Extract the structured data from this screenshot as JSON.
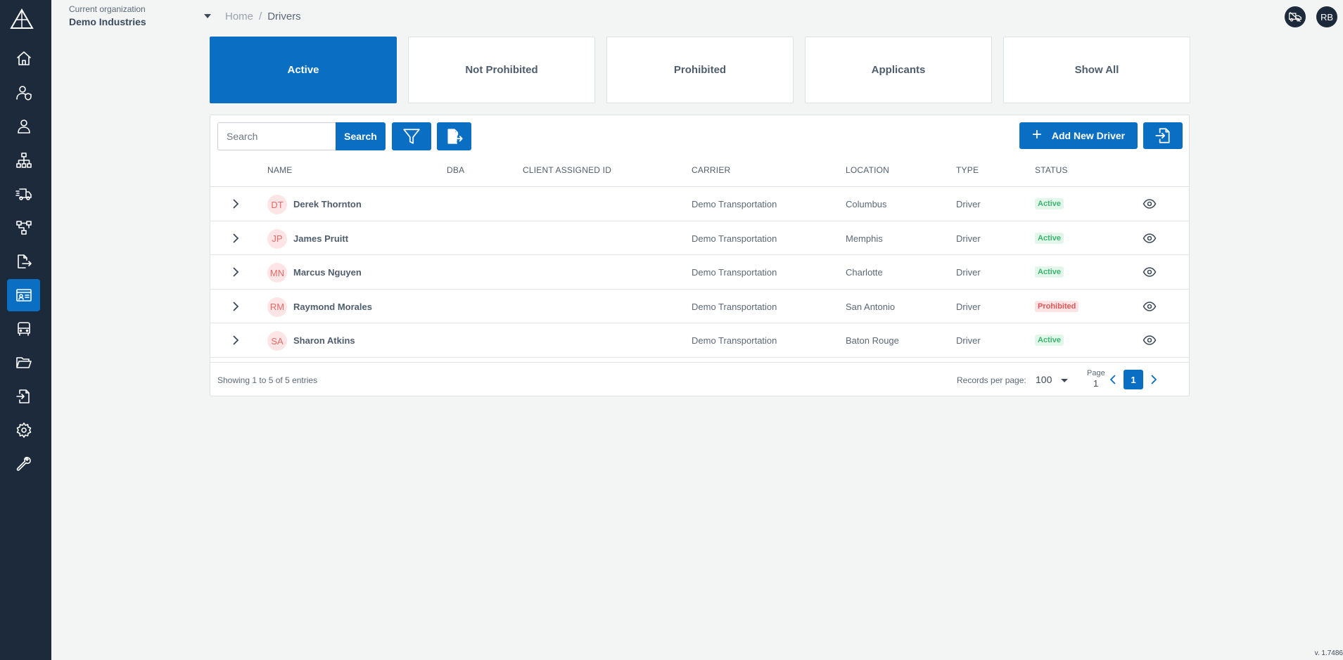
{
  "app": {
    "org_label": "Current organization",
    "org_name": "Demo Industries",
    "version": "v. 1.7486"
  },
  "header": {
    "breadcrumb": {
      "home": "Home",
      "separator": "/",
      "current": "Drivers"
    },
    "user_initials": "RB"
  },
  "sidebar": {
    "items": [
      {
        "icon": "home-icon"
      },
      {
        "icon": "user-shield-icon"
      },
      {
        "icon": "user-icon"
      },
      {
        "icon": "org-chart-icon"
      },
      {
        "icon": "truck-fast-icon"
      },
      {
        "icon": "workflow-icon"
      },
      {
        "icon": "file-export-icon"
      },
      {
        "icon": "id-card-icon",
        "active": true
      },
      {
        "icon": "vehicle-icon"
      },
      {
        "icon": "folder-open-icon"
      },
      {
        "icon": "file-import-icon"
      },
      {
        "icon": "settings-gear-icon"
      },
      {
        "icon": "wrench-icon"
      }
    ]
  },
  "tabs": [
    {
      "label": "Active",
      "active": true
    },
    {
      "label": "Not Prohibited"
    },
    {
      "label": "Prohibited"
    },
    {
      "label": "Applicants"
    },
    {
      "label": "Show All"
    }
  ],
  "toolbar": {
    "search_placeholder": "Search",
    "search_label": "Search",
    "add_label": "Add New Driver"
  },
  "table": {
    "columns": {
      "name": "NAME",
      "dba": "DBA",
      "client_id": "CLIENT ASSIGNED ID",
      "carrier": "CARRIER",
      "location": "LOCATION",
      "type": "TYPE",
      "status": "STATUS"
    },
    "rows": [
      {
        "initials": "DT",
        "name": "Derek Thornton",
        "dba": "",
        "client_id": "",
        "carrier": "Demo Transportation",
        "location": "Columbus",
        "type": "Driver",
        "status": "Active"
      },
      {
        "initials": "JP",
        "name": "James Pruitt",
        "dba": "",
        "client_id": "",
        "carrier": "Demo Transportation",
        "location": "Memphis",
        "type": "Driver",
        "status": "Active"
      },
      {
        "initials": "MN",
        "name": "Marcus Nguyen",
        "dba": "",
        "client_id": "",
        "carrier": "Demo Transportation",
        "location": "Charlotte",
        "type": "Driver",
        "status": "Active"
      },
      {
        "initials": "RM",
        "name": "Raymond Morales",
        "dba": "",
        "client_id": "",
        "carrier": "Demo Transportation",
        "location": "San Antonio",
        "type": "Driver",
        "status": "Prohibited"
      },
      {
        "initials": "SA",
        "name": "Sharon Atkins",
        "dba": "",
        "client_id": "",
        "carrier": "Demo Transportation",
        "location": "Baton Rouge",
        "type": "Driver",
        "status": "Active"
      }
    ]
  },
  "footer": {
    "showing": "Showing 1 to 5 of 5 entries",
    "records_label": "Records per page:",
    "records_value": "100",
    "page_label": "Page",
    "page_value": "1",
    "current_page": "1"
  },
  "colors": {
    "sidebar_bg": "#1c2a3b",
    "accent": "#0a6fc2",
    "status_active": "#3cb371",
    "status_prohibited": "#e05656"
  }
}
